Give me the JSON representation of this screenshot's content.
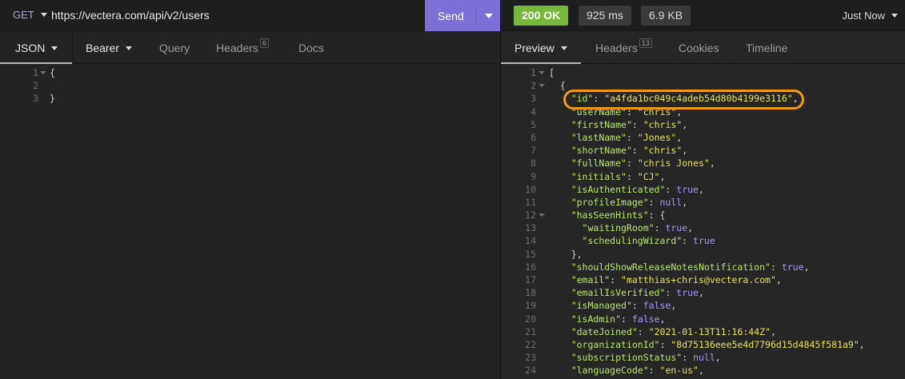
{
  "request": {
    "method": "GET",
    "url": "https://vectera.com/api/v2/users",
    "send_label": "Send",
    "tabs": [
      {
        "label": "JSON"
      },
      {
        "label": "Bearer"
      },
      {
        "label": "Query"
      },
      {
        "label": "Headers",
        "badge": "6"
      },
      {
        "label": "Docs"
      }
    ],
    "body_lines": [
      "{",
      "",
      "}"
    ]
  },
  "response": {
    "status": "200 OK",
    "time": "925 ms",
    "size": "6.9 KB",
    "history": "Just Now",
    "tabs": [
      {
        "label": "Preview"
      },
      {
        "label": "Headers",
        "badge": "13"
      },
      {
        "label": "Cookies"
      },
      {
        "label": "Timeline"
      }
    ],
    "lines": [
      "[",
      "  {",
      "    \"id\": \"a4fda1bc049c4adeb54d80b4199e3116\",",
      "    \"userName\": \"chris\",",
      "    \"firstName\": \"chris\",",
      "    \"lastName\": \"Jones\",",
      "    \"shortName\": \"chris\",",
      "    \"fullName\": \"chris Jones\",",
      "    \"initials\": \"CJ\",",
      "    \"isAuthenticated\": true,",
      "    \"profileImage\": null,",
      "    \"hasSeenHints\": {",
      "      \"waitingRoom\": true,",
      "      \"schedulingWizard\": true",
      "    },",
      "    \"shouldShowReleaseNotesNotification\": true,",
      "    \"email\": \"matthias+chris@vectera.com\",",
      "    \"emailIsVerified\": true,",
      "    \"isManaged\": false,",
      "    \"isAdmin\": false,",
      "    \"dateJoined\": \"2021-01-13T11:16:44Z\",",
      "    \"organizationId\": \"8d75136eee5e4d7796d15d4845f581a9\",",
      "    \"subscriptionStatus\": null,",
      "    \"languageCode\": \"en-us\","
    ],
    "fold_lines": [
      1,
      2,
      12
    ]
  },
  "colors": {
    "accent": "#7c6fd6",
    "status_ok": "#76b839",
    "highlight": "#f09a1a",
    "json_key": "#b9e66c",
    "json_string": "#e8e25a",
    "json_literal": "#a49bf0"
  }
}
